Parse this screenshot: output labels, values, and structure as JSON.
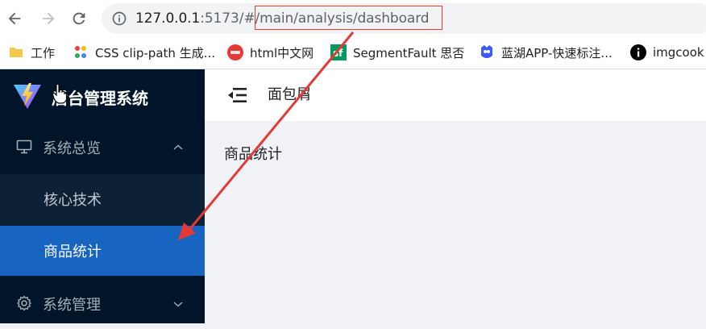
{
  "browser": {
    "url_host": "127.0.0.1",
    "url_rest": ":5173/#/",
    "url_path": "main/analysis/dashboard",
    "bookmarks": [
      {
        "label": "工作",
        "icon": "folder-icon"
      },
      {
        "label": "CSS clip-path 生成...",
        "icon": "dots-logo-icon"
      },
      {
        "label": "html中文网",
        "icon": "html-logo-icon"
      },
      {
        "label": "SegmentFault 思否",
        "icon": "segmentfault-logo-icon"
      },
      {
        "label": "蓝湖APP-快速标注...",
        "icon": "lanhu-logo-icon"
      },
      {
        "label": "imgcook",
        "icon": "info-circle-icon"
      }
    ]
  },
  "app": {
    "title": "后台管理系统",
    "breadcrumb": "面包屑",
    "content_title": "商品统计",
    "menu": {
      "overview": {
        "label": "系统总览",
        "icon": "monitor-icon"
      },
      "overview_children": [
        {
          "label": "核心技术",
          "active": false
        },
        {
          "label": "商品统计",
          "active": true
        }
      ],
      "system": {
        "label": "系统管理",
        "icon": "gear-icon"
      }
    }
  },
  "colors": {
    "sidebar_bg": "#001529",
    "submenu_bg": "#0c2135",
    "active_item": "#1765c0",
    "annotation_red": "#e53935"
  }
}
